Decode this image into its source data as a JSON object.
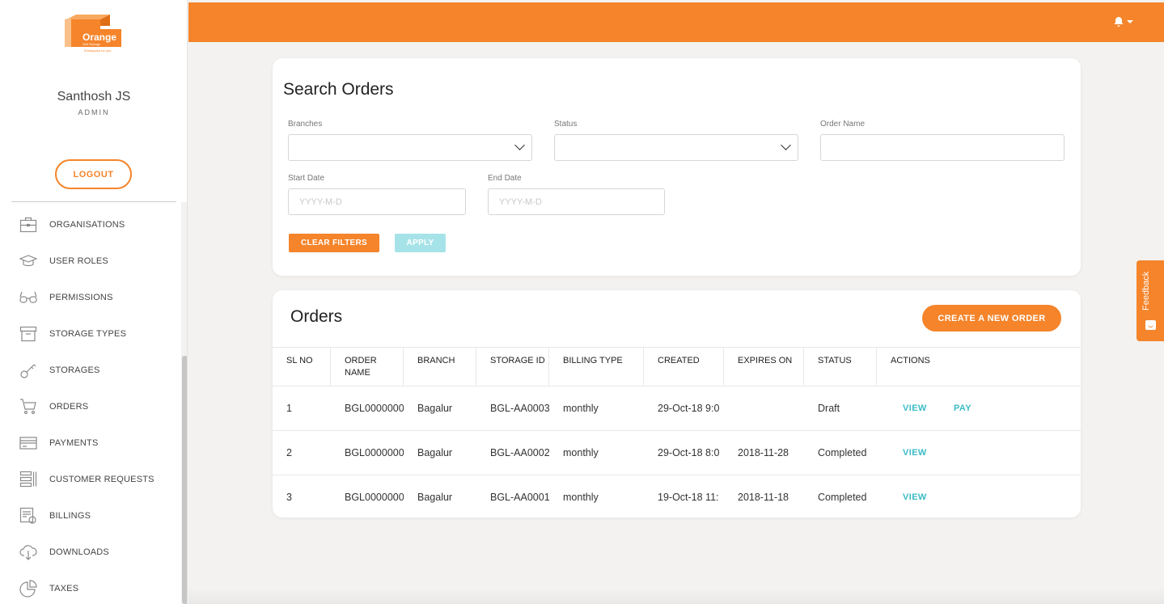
{
  "brand": {
    "name": "Orange",
    "sub": "Self Storage",
    "tagline": "Extraspace for you",
    "accent": "#f5842a",
    "link_color": "#3bbcc6"
  },
  "user": {
    "name": "Santhosh JS",
    "role": "ADMIN",
    "logout_label": "LOGOUT"
  },
  "sidebar": {
    "items": [
      {
        "label": "ORGANISATIONS",
        "icon": "briefcase-icon"
      },
      {
        "label": "USER ROLES",
        "icon": "graduation-cap-icon"
      },
      {
        "label": "PERMISSIONS",
        "icon": "glasses-icon"
      },
      {
        "label": "STORAGE TYPES",
        "icon": "archive-box-icon"
      },
      {
        "label": "STORAGES",
        "icon": "key-icon"
      },
      {
        "label": "ORDERS",
        "icon": "cart-icon"
      },
      {
        "label": "PAYMENTS",
        "icon": "credit-card-icon"
      },
      {
        "label": "CUSTOMER REQUESTS",
        "icon": "list-icon"
      },
      {
        "label": "BILLINGS",
        "icon": "billing-icon"
      },
      {
        "label": "DOWNLOADS",
        "icon": "cloud-download-icon"
      },
      {
        "label": "TAXES",
        "icon": "pie-chart-icon"
      }
    ]
  },
  "topbar": {
    "icon": "bell-icon"
  },
  "search": {
    "title": "Search Orders",
    "branches_label": "Branches",
    "branches_value": "",
    "status_label": "Status",
    "status_value": "",
    "order_name_label": "Order Name",
    "order_name_value": "",
    "start_date_label": "Start Date",
    "start_date_placeholder": "YYYY-M-D",
    "end_date_label": "End Date",
    "end_date_placeholder": "YYYY-M-D",
    "clear_label": "CLEAR FILTERS",
    "apply_label": "APPLY"
  },
  "orders": {
    "title": "Orders",
    "create_label": "CREATE A NEW ORDER",
    "headers": [
      "SL NO",
      "ORDER NAME",
      "BRANCH",
      "STORAGE ID",
      "BILLING TYPE",
      "CREATED",
      "EXPIRES ON",
      "STATUS",
      "ACTIONS"
    ],
    "rows": [
      {
        "sl": "1",
        "order": "BGL0000000",
        "branch": "Bagalur",
        "storage": "BGL-AA0003",
        "billing": "monthly",
        "created": "29-Oct-18 9:0",
        "expires": "",
        "status": "Draft",
        "view": "VIEW",
        "pay": "PAY"
      },
      {
        "sl": "2",
        "order": "BGL0000000",
        "branch": "Bagalur",
        "storage": "BGL-AA0002",
        "billing": "monthly",
        "created": "29-Oct-18 8:0",
        "expires": "2018-11-28",
        "status": "Completed",
        "view": "VIEW",
        "pay": ""
      },
      {
        "sl": "3",
        "order": "BGL0000000",
        "branch": "Bagalur",
        "storage": "BGL-AA0001",
        "billing": "monthly",
        "created": "19-Oct-18 11:",
        "expires": "2018-11-18",
        "status": "Completed",
        "view": "VIEW",
        "pay": ""
      }
    ]
  },
  "feedback": {
    "label": "Feedback",
    "icon": "smile-icon"
  }
}
